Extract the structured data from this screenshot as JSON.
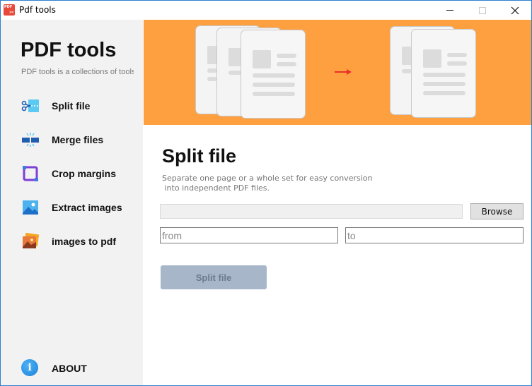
{
  "window": {
    "title": "Pdf tools",
    "icon": "pdf-scissors-icon",
    "controls": [
      "minimize-icon",
      "maximize-icon",
      "close-icon"
    ]
  },
  "sidebar": {
    "brand": "PDF tools",
    "description": "PDF tools is a collections of tools that will works with pdf files",
    "items": [
      {
        "label": "Split file",
        "icon": "scissors-icon"
      },
      {
        "label": "Merge files",
        "icon": "merge-icon"
      },
      {
        "label": "Crop margins",
        "icon": "crop-icon"
      },
      {
        "label": "Extract images",
        "icon": "image-icon"
      },
      {
        "label": "images to pdf",
        "icon": "images-stack-icon"
      }
    ],
    "about": {
      "label": "ABOUT",
      "icon": "info-icon",
      "glyph": "i"
    }
  },
  "banner": {
    "background": "#ffa040",
    "arrow_color": "#e8312a"
  },
  "main": {
    "title": "Split file",
    "description": "Separate one page or a whole set for easy conversion\n into independent PDF files.",
    "file_path_value": "",
    "browse_label": "Browse",
    "from_placeholder": "from",
    "to_placeholder": "to",
    "split_button_label": "Split file"
  }
}
